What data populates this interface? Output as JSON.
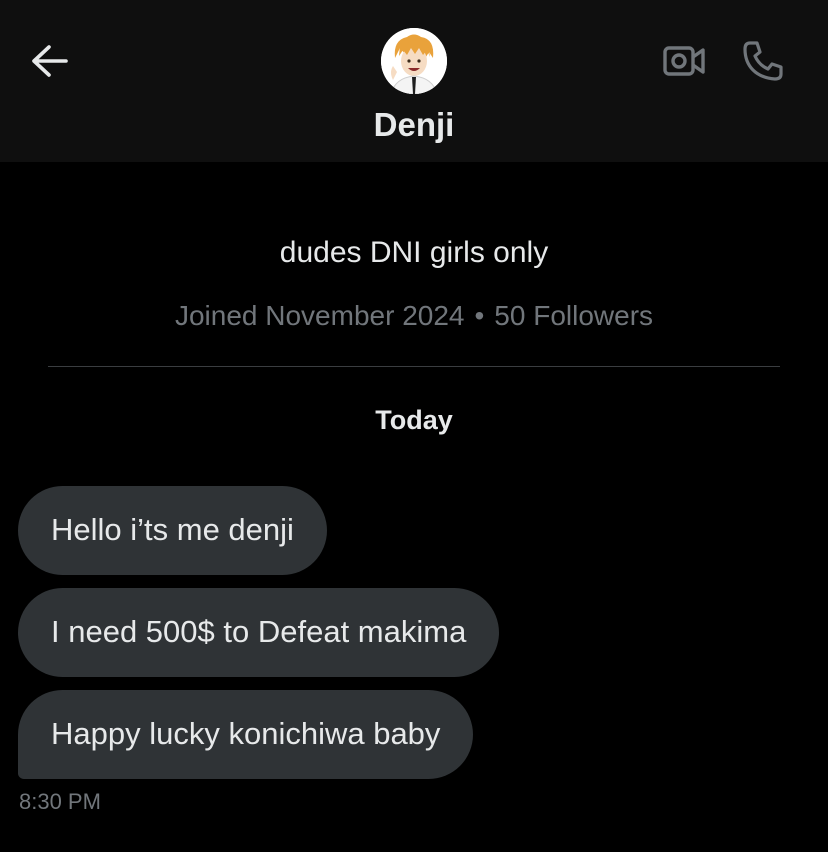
{
  "header": {
    "contact_name": "Denji"
  },
  "profile": {
    "bio": "dudes DNI girls only",
    "joined": "Joined November 2024",
    "separator": "•",
    "followers": "50 Followers"
  },
  "conversation": {
    "day_label": "Today",
    "messages": [
      {
        "text": "Hello i’ts me denji"
      },
      {
        "text": "I need 500$ to Defeat makima"
      },
      {
        "text": "Happy lucky konichiwa baby"
      }
    ],
    "timestamp": "8:30 PM"
  },
  "colors": {
    "background": "#000000",
    "header_background": "#0f0f0f",
    "bubble_background": "#2f3336",
    "primary_text": "#e7e9ea",
    "secondary_text": "#71767b",
    "avatar_hair": "#e9a23b"
  },
  "icons": {
    "back": "arrow-left-icon",
    "video": "video-camera-icon",
    "call": "phone-icon"
  }
}
